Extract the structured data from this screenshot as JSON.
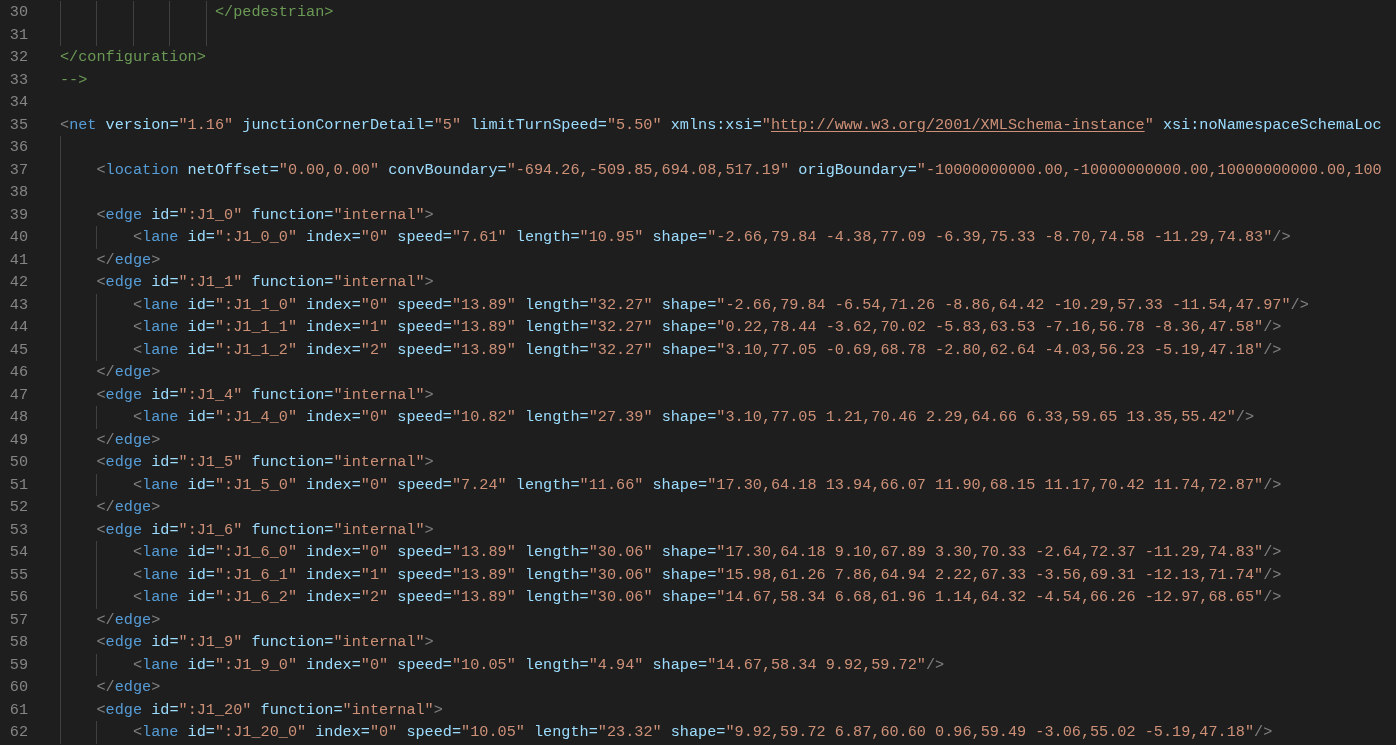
{
  "editor": {
    "lines": [
      {
        "number": "30",
        "kind": "comment",
        "tokens": [
          {
            "kind": "comment",
            "text": "</pedestrian>"
          }
        ]
      },
      {
        "number": "31",
        "kind": "comment"
      },
      {
        "number": "32",
        "kind": "top",
        "tokens": [
          {
            "kind": "comment",
            "text": "</configuration>"
          }
        ]
      },
      {
        "number": "33",
        "kind": "top",
        "tokens": [
          {
            "kind": "comment",
            "text": "-->"
          }
        ]
      },
      {
        "number": "34",
        "kind": "top"
      },
      {
        "number": "35",
        "kind": "top",
        "tokens": [
          {
            "kind": "p",
            "text": "<"
          },
          {
            "kind": "tag",
            "text": "net"
          },
          {
            "kind": "attr",
            "text": " version="
          },
          {
            "kind": "str",
            "text": "\"1.16\""
          },
          {
            "kind": "attr",
            "text": " junctionCornerDetail="
          },
          {
            "kind": "str",
            "text": "\"5\""
          },
          {
            "kind": "attr",
            "text": " limitTurnSpeed="
          },
          {
            "kind": "str",
            "text": "\"5.50\""
          },
          {
            "kind": "attr",
            "text": " xmlns:xsi="
          },
          {
            "kind": "str",
            "text": "\""
          },
          {
            "kind": "link",
            "text": "http://www.w3.org/2001/XMLSchema-instance"
          },
          {
            "kind": "str",
            "text": "\""
          },
          {
            "kind": "attr",
            "text": " xsi:noNamespaceSchemaLoc"
          }
        ]
      },
      {
        "number": "36",
        "kind": "inner"
      },
      {
        "number": "37",
        "kind": "inner",
        "tokens": [
          {
            "kind": "p",
            "text": "<"
          },
          {
            "kind": "tag",
            "text": "location"
          },
          {
            "kind": "attr",
            "text": " netOffset="
          },
          {
            "kind": "str",
            "text": "\"0.00,0.00\""
          },
          {
            "kind": "attr",
            "text": " convBoundary="
          },
          {
            "kind": "str",
            "text": "\"-694.26,-509.85,694.08,517.19\""
          },
          {
            "kind": "attr",
            "text": " origBoundary="
          },
          {
            "kind": "str",
            "text": "\"-10000000000.00,-10000000000.00,10000000000.00,100"
          }
        ]
      },
      {
        "number": "38",
        "kind": "inner"
      },
      {
        "number": "39",
        "kind": "inner",
        "tokens": [
          {
            "kind": "p",
            "text": "<"
          },
          {
            "kind": "tag",
            "text": "edge"
          },
          {
            "kind": "attr",
            "text": " id="
          },
          {
            "kind": "str",
            "text": "\":J1_0\""
          },
          {
            "kind": "attr",
            "text": " function="
          },
          {
            "kind": "str",
            "text": "\"internal\""
          },
          {
            "kind": "p",
            "text": ">"
          }
        ]
      },
      {
        "number": "40",
        "kind": "deep",
        "tokens": [
          {
            "kind": "p",
            "text": "<"
          },
          {
            "kind": "tag",
            "text": "lane"
          },
          {
            "kind": "attr",
            "text": " id="
          },
          {
            "kind": "str",
            "text": "\":J1_0_0\""
          },
          {
            "kind": "attr",
            "text": " index="
          },
          {
            "kind": "str",
            "text": "\"0\""
          },
          {
            "kind": "attr",
            "text": " speed="
          },
          {
            "kind": "str",
            "text": "\"7.61\""
          },
          {
            "kind": "attr",
            "text": " length="
          },
          {
            "kind": "str",
            "text": "\"10.95\""
          },
          {
            "kind": "attr",
            "text": " shape="
          },
          {
            "kind": "str",
            "text": "\"-2.66,79.84 -4.38,77.09 -6.39,75.33 -8.70,74.58 -11.29,74.83\""
          },
          {
            "kind": "p",
            "text": "/>"
          }
        ]
      },
      {
        "number": "41",
        "kind": "inner",
        "tokens": [
          {
            "kind": "p",
            "text": "</"
          },
          {
            "kind": "tag",
            "text": "edge"
          },
          {
            "kind": "p",
            "text": ">"
          }
        ]
      },
      {
        "number": "42",
        "kind": "inner",
        "tokens": [
          {
            "kind": "p",
            "text": "<"
          },
          {
            "kind": "tag",
            "text": "edge"
          },
          {
            "kind": "attr",
            "text": " id="
          },
          {
            "kind": "str",
            "text": "\":J1_1\""
          },
          {
            "kind": "attr",
            "text": " function="
          },
          {
            "kind": "str",
            "text": "\"internal\""
          },
          {
            "kind": "p",
            "text": ">"
          }
        ]
      },
      {
        "number": "43",
        "kind": "deep",
        "tokens": [
          {
            "kind": "p",
            "text": "<"
          },
          {
            "kind": "tag",
            "text": "lane"
          },
          {
            "kind": "attr",
            "text": " id="
          },
          {
            "kind": "str",
            "text": "\":J1_1_0\""
          },
          {
            "kind": "attr",
            "text": " index="
          },
          {
            "kind": "str",
            "text": "\"0\""
          },
          {
            "kind": "attr",
            "text": " speed="
          },
          {
            "kind": "str",
            "text": "\"13.89\""
          },
          {
            "kind": "attr",
            "text": " length="
          },
          {
            "kind": "str",
            "text": "\"32.27\""
          },
          {
            "kind": "attr",
            "text": " shape="
          },
          {
            "kind": "str",
            "text": "\"-2.66,79.84 -6.54,71.26 -8.86,64.42 -10.29,57.33 -11.54,47.97\""
          },
          {
            "kind": "p",
            "text": "/>"
          }
        ]
      },
      {
        "number": "44",
        "kind": "deep",
        "tokens": [
          {
            "kind": "p",
            "text": "<"
          },
          {
            "kind": "tag",
            "text": "lane"
          },
          {
            "kind": "attr",
            "text": " id="
          },
          {
            "kind": "str",
            "text": "\":J1_1_1\""
          },
          {
            "kind": "attr",
            "text": " index="
          },
          {
            "kind": "str",
            "text": "\"1\""
          },
          {
            "kind": "attr",
            "text": " speed="
          },
          {
            "kind": "str",
            "text": "\"13.89\""
          },
          {
            "kind": "attr",
            "text": " length="
          },
          {
            "kind": "str",
            "text": "\"32.27\""
          },
          {
            "kind": "attr",
            "text": " shape="
          },
          {
            "kind": "str",
            "text": "\"0.22,78.44 -3.62,70.02 -5.83,63.53 -7.16,56.78 -8.36,47.58\""
          },
          {
            "kind": "p",
            "text": "/>"
          }
        ]
      },
      {
        "number": "45",
        "kind": "deep",
        "tokens": [
          {
            "kind": "p",
            "text": "<"
          },
          {
            "kind": "tag",
            "text": "lane"
          },
          {
            "kind": "attr",
            "text": " id="
          },
          {
            "kind": "str",
            "text": "\":J1_1_2\""
          },
          {
            "kind": "attr",
            "text": " index="
          },
          {
            "kind": "str",
            "text": "\"2\""
          },
          {
            "kind": "attr",
            "text": " speed="
          },
          {
            "kind": "str",
            "text": "\"13.89\""
          },
          {
            "kind": "attr",
            "text": " length="
          },
          {
            "kind": "str",
            "text": "\"32.27\""
          },
          {
            "kind": "attr",
            "text": " shape="
          },
          {
            "kind": "str",
            "text": "\"3.10,77.05 -0.69,68.78 -2.80,62.64 -4.03,56.23 -5.19,47.18\""
          },
          {
            "kind": "p",
            "text": "/>"
          }
        ]
      },
      {
        "number": "46",
        "kind": "inner",
        "tokens": [
          {
            "kind": "p",
            "text": "</"
          },
          {
            "kind": "tag",
            "text": "edge"
          },
          {
            "kind": "p",
            "text": ">"
          }
        ]
      },
      {
        "number": "47",
        "kind": "inner",
        "tokens": [
          {
            "kind": "p",
            "text": "<"
          },
          {
            "kind": "tag",
            "text": "edge"
          },
          {
            "kind": "attr",
            "text": " id="
          },
          {
            "kind": "str",
            "text": "\":J1_4\""
          },
          {
            "kind": "attr",
            "text": " function="
          },
          {
            "kind": "str",
            "text": "\"internal\""
          },
          {
            "kind": "p",
            "text": ">"
          }
        ]
      },
      {
        "number": "48",
        "kind": "deep",
        "tokens": [
          {
            "kind": "p",
            "text": "<"
          },
          {
            "kind": "tag",
            "text": "lane"
          },
          {
            "kind": "attr",
            "text": " id="
          },
          {
            "kind": "str",
            "text": "\":J1_4_0\""
          },
          {
            "kind": "attr",
            "text": " index="
          },
          {
            "kind": "str",
            "text": "\"0\""
          },
          {
            "kind": "attr",
            "text": " speed="
          },
          {
            "kind": "str",
            "text": "\"10.82\""
          },
          {
            "kind": "attr",
            "text": " length="
          },
          {
            "kind": "str",
            "text": "\"27.39\""
          },
          {
            "kind": "attr",
            "text": " shape="
          },
          {
            "kind": "str",
            "text": "\"3.10,77.05 1.21,70.46 2.29,64.66 6.33,59.65 13.35,55.42\""
          },
          {
            "kind": "p",
            "text": "/>"
          }
        ]
      },
      {
        "number": "49",
        "kind": "inner",
        "tokens": [
          {
            "kind": "p",
            "text": "</"
          },
          {
            "kind": "tag",
            "text": "edge"
          },
          {
            "kind": "p",
            "text": ">"
          }
        ]
      },
      {
        "number": "50",
        "kind": "inner",
        "tokens": [
          {
            "kind": "p",
            "text": "<"
          },
          {
            "kind": "tag",
            "text": "edge"
          },
          {
            "kind": "attr",
            "text": " id="
          },
          {
            "kind": "str",
            "text": "\":J1_5\""
          },
          {
            "kind": "attr",
            "text": " function="
          },
          {
            "kind": "str",
            "text": "\"internal\""
          },
          {
            "kind": "p",
            "text": ">"
          }
        ]
      },
      {
        "number": "51",
        "kind": "deep",
        "tokens": [
          {
            "kind": "p",
            "text": "<"
          },
          {
            "kind": "tag",
            "text": "lane"
          },
          {
            "kind": "attr",
            "text": " id="
          },
          {
            "kind": "str",
            "text": "\":J1_5_0\""
          },
          {
            "kind": "attr",
            "text": " index="
          },
          {
            "kind": "str",
            "text": "\"0\""
          },
          {
            "kind": "attr",
            "text": " speed="
          },
          {
            "kind": "str",
            "text": "\"7.24\""
          },
          {
            "kind": "attr",
            "text": " length="
          },
          {
            "kind": "str",
            "text": "\"11.66\""
          },
          {
            "kind": "attr",
            "text": " shape="
          },
          {
            "kind": "str",
            "text": "\"17.30,64.18 13.94,66.07 11.90,68.15 11.17,70.42 11.74,72.87\""
          },
          {
            "kind": "p",
            "text": "/>"
          }
        ]
      },
      {
        "number": "52",
        "kind": "inner",
        "tokens": [
          {
            "kind": "p",
            "text": "</"
          },
          {
            "kind": "tag",
            "text": "edge"
          },
          {
            "kind": "p",
            "text": ">"
          }
        ]
      },
      {
        "number": "53",
        "kind": "inner",
        "tokens": [
          {
            "kind": "p",
            "text": "<"
          },
          {
            "kind": "tag",
            "text": "edge"
          },
          {
            "kind": "attr",
            "text": " id="
          },
          {
            "kind": "str",
            "text": "\":J1_6\""
          },
          {
            "kind": "attr",
            "text": " function="
          },
          {
            "kind": "str",
            "text": "\"internal\""
          },
          {
            "kind": "p",
            "text": ">"
          }
        ]
      },
      {
        "number": "54",
        "kind": "deep",
        "tokens": [
          {
            "kind": "p",
            "text": "<"
          },
          {
            "kind": "tag",
            "text": "lane"
          },
          {
            "kind": "attr",
            "text": " id="
          },
          {
            "kind": "str",
            "text": "\":J1_6_0\""
          },
          {
            "kind": "attr",
            "text": " index="
          },
          {
            "kind": "str",
            "text": "\"0\""
          },
          {
            "kind": "attr",
            "text": " speed="
          },
          {
            "kind": "str",
            "text": "\"13.89\""
          },
          {
            "kind": "attr",
            "text": " length="
          },
          {
            "kind": "str",
            "text": "\"30.06\""
          },
          {
            "kind": "attr",
            "text": " shape="
          },
          {
            "kind": "str",
            "text": "\"17.30,64.18 9.10,67.89 3.30,70.33 -2.64,72.37 -11.29,74.83\""
          },
          {
            "kind": "p",
            "text": "/>"
          }
        ]
      },
      {
        "number": "55",
        "kind": "deep",
        "tokens": [
          {
            "kind": "p",
            "text": "<"
          },
          {
            "kind": "tag",
            "text": "lane"
          },
          {
            "kind": "attr",
            "text": " id="
          },
          {
            "kind": "str",
            "text": "\":J1_6_1\""
          },
          {
            "kind": "attr",
            "text": " index="
          },
          {
            "kind": "str",
            "text": "\"1\""
          },
          {
            "kind": "attr",
            "text": " speed="
          },
          {
            "kind": "str",
            "text": "\"13.89\""
          },
          {
            "kind": "attr",
            "text": " length="
          },
          {
            "kind": "str",
            "text": "\"30.06\""
          },
          {
            "kind": "attr",
            "text": " shape="
          },
          {
            "kind": "str",
            "text": "\"15.98,61.26 7.86,64.94 2.22,67.33 -3.56,69.31 -12.13,71.74\""
          },
          {
            "kind": "p",
            "text": "/>"
          }
        ]
      },
      {
        "number": "56",
        "kind": "deep",
        "tokens": [
          {
            "kind": "p",
            "text": "<"
          },
          {
            "kind": "tag",
            "text": "lane"
          },
          {
            "kind": "attr",
            "text": " id="
          },
          {
            "kind": "str",
            "text": "\":J1_6_2\""
          },
          {
            "kind": "attr",
            "text": " index="
          },
          {
            "kind": "str",
            "text": "\"2\""
          },
          {
            "kind": "attr",
            "text": " speed="
          },
          {
            "kind": "str",
            "text": "\"13.89\""
          },
          {
            "kind": "attr",
            "text": " length="
          },
          {
            "kind": "str",
            "text": "\"30.06\""
          },
          {
            "kind": "attr",
            "text": " shape="
          },
          {
            "kind": "str",
            "text": "\"14.67,58.34 6.68,61.96 1.14,64.32 -4.54,66.26 -12.97,68.65\""
          },
          {
            "kind": "p",
            "text": "/>"
          }
        ]
      },
      {
        "number": "57",
        "kind": "inner",
        "tokens": [
          {
            "kind": "p",
            "text": "</"
          },
          {
            "kind": "tag",
            "text": "edge"
          },
          {
            "kind": "p",
            "text": ">"
          }
        ]
      },
      {
        "number": "58",
        "kind": "inner",
        "tokens": [
          {
            "kind": "p",
            "text": "<"
          },
          {
            "kind": "tag",
            "text": "edge"
          },
          {
            "kind": "attr",
            "text": " id="
          },
          {
            "kind": "str",
            "text": "\":J1_9\""
          },
          {
            "kind": "attr",
            "text": " function="
          },
          {
            "kind": "str",
            "text": "\"internal\""
          },
          {
            "kind": "p",
            "text": ">"
          }
        ]
      },
      {
        "number": "59",
        "kind": "deep",
        "tokens": [
          {
            "kind": "p",
            "text": "<"
          },
          {
            "kind": "tag",
            "text": "lane"
          },
          {
            "kind": "attr",
            "text": " id="
          },
          {
            "kind": "str",
            "text": "\":J1_9_0\""
          },
          {
            "kind": "attr",
            "text": " index="
          },
          {
            "kind": "str",
            "text": "\"0\""
          },
          {
            "kind": "attr",
            "text": " speed="
          },
          {
            "kind": "str",
            "text": "\"10.05\""
          },
          {
            "kind": "attr",
            "text": " length="
          },
          {
            "kind": "str",
            "text": "\"4.94\""
          },
          {
            "kind": "attr",
            "text": " shape="
          },
          {
            "kind": "str",
            "text": "\"14.67,58.34 9.92,59.72\""
          },
          {
            "kind": "p",
            "text": "/>"
          }
        ]
      },
      {
        "number": "60",
        "kind": "inner",
        "tokens": [
          {
            "kind": "p",
            "text": "</"
          },
          {
            "kind": "tag",
            "text": "edge"
          },
          {
            "kind": "p",
            "text": ">"
          }
        ]
      },
      {
        "number": "61",
        "kind": "inner",
        "tokens": [
          {
            "kind": "p",
            "text": "<"
          },
          {
            "kind": "tag",
            "text": "edge"
          },
          {
            "kind": "attr",
            "text": " id="
          },
          {
            "kind": "str",
            "text": "\":J1_20\""
          },
          {
            "kind": "attr",
            "text": " function="
          },
          {
            "kind": "str",
            "text": "\"internal\""
          },
          {
            "kind": "p",
            "text": ">"
          }
        ]
      },
      {
        "number": "62",
        "kind": "deep",
        "tokens": [
          {
            "kind": "p",
            "text": "<"
          },
          {
            "kind": "tag",
            "text": "lane"
          },
          {
            "kind": "attr",
            "text": " id="
          },
          {
            "kind": "str",
            "text": "\":J1_20_0\""
          },
          {
            "kind": "attr",
            "text": " index="
          },
          {
            "kind": "str",
            "text": "\"0\""
          },
          {
            "kind": "attr",
            "text": " speed="
          },
          {
            "kind": "str",
            "text": "\"10.05\""
          },
          {
            "kind": "attr",
            "text": " length="
          },
          {
            "kind": "str",
            "text": "\"23.32\""
          },
          {
            "kind": "attr",
            "text": " shape="
          },
          {
            "kind": "str",
            "text": "\"9.92,59.72 6.87,60.60 0.96,59.49 -3.06,55.02 -5.19,47.18\""
          },
          {
            "kind": "p",
            "text": "/>"
          }
        ]
      }
    ]
  }
}
